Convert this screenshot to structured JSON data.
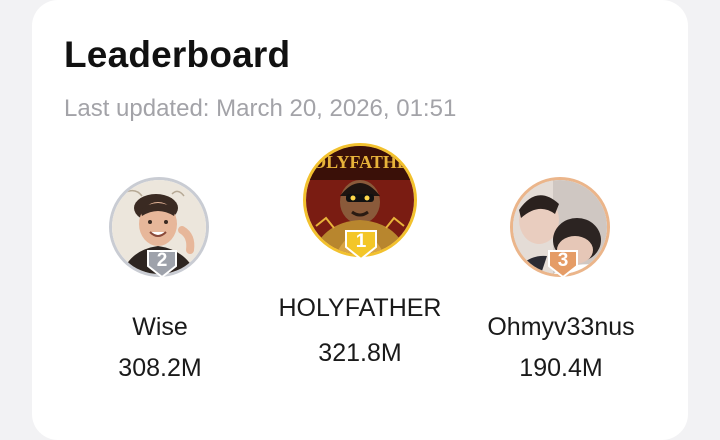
{
  "leaderboard": {
    "title": "Leaderboard",
    "last_updated": "Last updated: March 20, 2026, 01:51",
    "entries": [
      {
        "rank": "2",
        "name": "Wise",
        "score": "308.2M",
        "ring_color": "#c9ccd3",
        "badge_color": "#9ea2ab"
      },
      {
        "rank": "1",
        "name": "HOLYFATHER",
        "score": "321.8M",
        "ring_color": "#f2c12e",
        "badge_color": "#f3c628"
      },
      {
        "rank": "3",
        "name": "Ohmyv33nus",
        "score": "190.4M",
        "ring_color": "#ebb58a",
        "badge_color": "#e59c66"
      }
    ]
  }
}
